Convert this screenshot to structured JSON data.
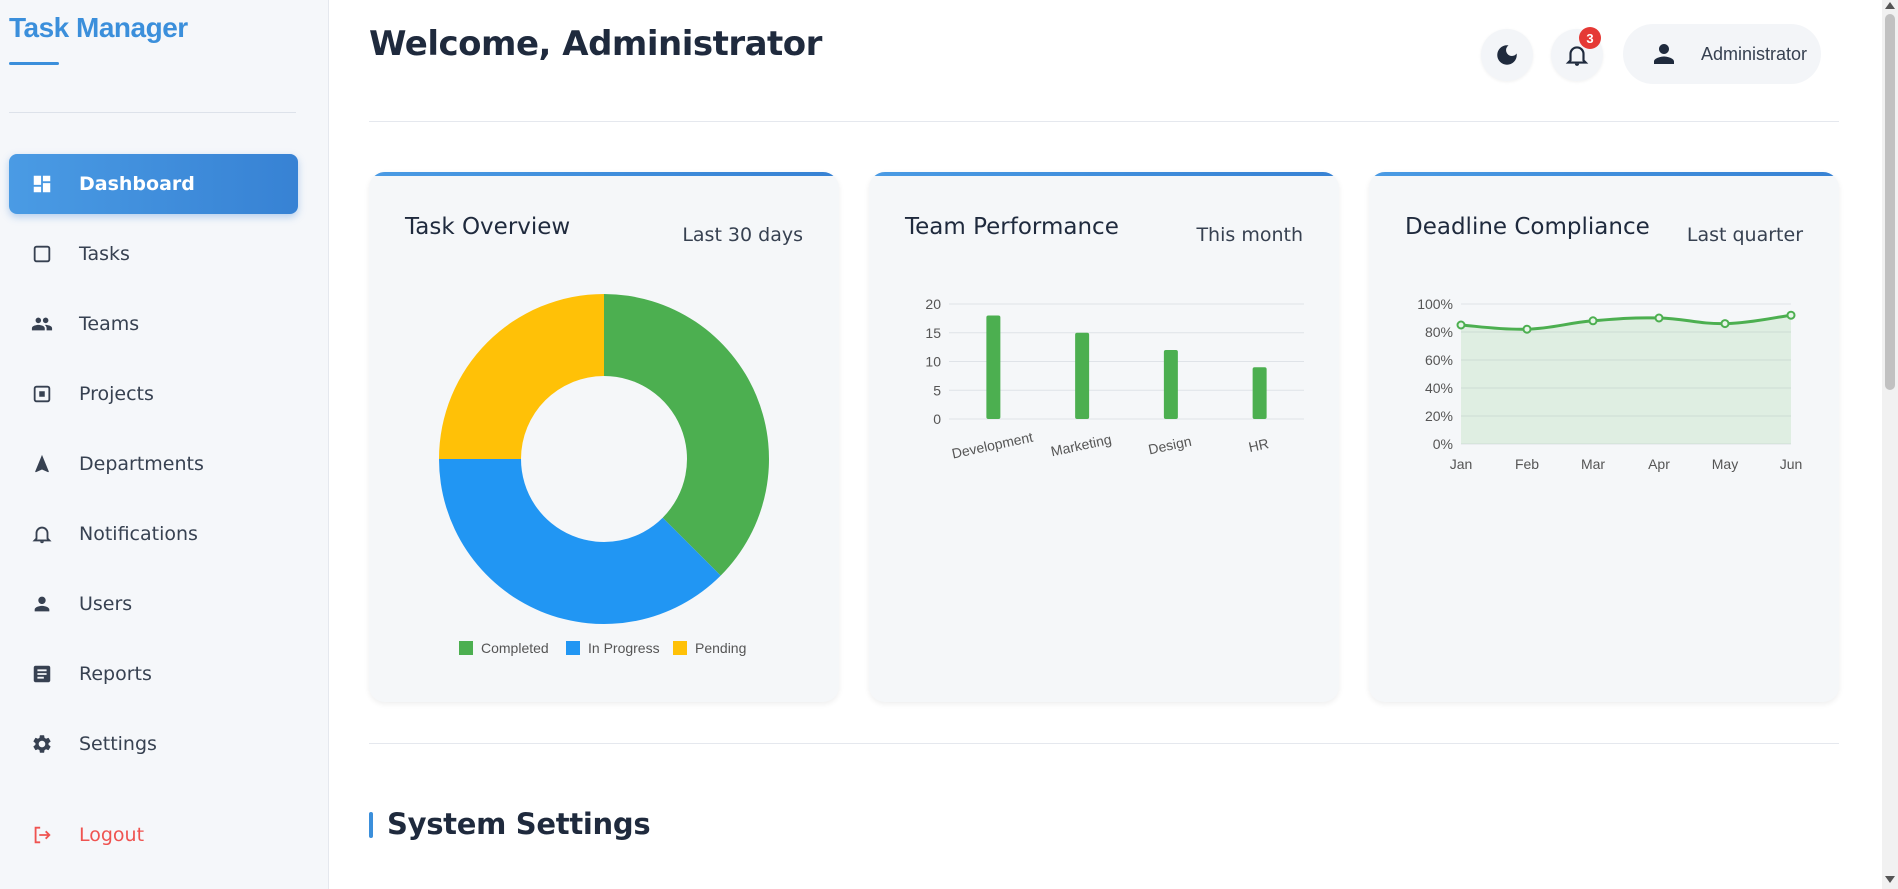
{
  "app": {
    "title": "Task Manager"
  },
  "sidebar": {
    "items": [
      {
        "label": "Dashboard",
        "icon": "dashboard-icon",
        "active": true
      },
      {
        "label": "Tasks",
        "icon": "checkbox-icon",
        "active": false
      },
      {
        "label": "Teams",
        "icon": "people-icon",
        "active": false
      },
      {
        "label": "Projects",
        "icon": "project-icon",
        "active": false
      },
      {
        "label": "Departments",
        "icon": "navigation-icon",
        "active": false
      },
      {
        "label": "Notifications",
        "icon": "bell-icon",
        "active": false
      },
      {
        "label": "Users",
        "icon": "user-icon",
        "active": false
      },
      {
        "label": "Reports",
        "icon": "report-icon",
        "active": false
      },
      {
        "label": "Settings",
        "icon": "gear-icon",
        "active": false
      }
    ],
    "logout": {
      "label": "Logout",
      "icon": "logout-icon",
      "color": "#ef5350"
    }
  },
  "header": {
    "welcome": "Welcome, Administrator",
    "notification_count": "3",
    "user_name": "Administrator"
  },
  "cards": {
    "task_overview": {
      "title": "Task Overview",
      "period": "Last 30 days"
    },
    "team_performance": {
      "title": "Team Performance",
      "period": "This month"
    },
    "deadline_compliance": {
      "title": "Deadline Compliance",
      "period": "Last quarter"
    }
  },
  "section": {
    "title": "System Settings"
  },
  "colors": {
    "accent": "#3b8fdb",
    "completed": "#4caf50",
    "in_progress": "#2196f3",
    "pending": "#ffc107",
    "badge": "#e53935"
  },
  "chart_data": [
    {
      "type": "pie",
      "donut": true,
      "categories": [
        "Completed",
        "In Progress",
        "Pending"
      ],
      "values": [
        37.5,
        37.5,
        25
      ],
      "colors": [
        "#4caf50",
        "#2196f3",
        "#ffc107"
      ],
      "legend": "bottom"
    },
    {
      "type": "bar",
      "categories": [
        "Development",
        "Marketing",
        "Design",
        "HR"
      ],
      "values": [
        18,
        15,
        12,
        9
      ],
      "yticks": [
        "0",
        "5",
        "10",
        "15",
        "20"
      ],
      "ylim": [
        0,
        20
      ],
      "color": "#4caf50",
      "grid": true
    },
    {
      "type": "area",
      "categories": [
        "Jan",
        "Feb",
        "Mar",
        "Apr",
        "May",
        "Jun"
      ],
      "values": [
        85,
        82,
        88,
        90,
        86,
        92
      ],
      "yticks": [
        "0%",
        "20%",
        "40%",
        "60%",
        "80%",
        "100%"
      ],
      "ylim": [
        0,
        100
      ],
      "color": "#4caf50",
      "grid": true
    }
  ]
}
